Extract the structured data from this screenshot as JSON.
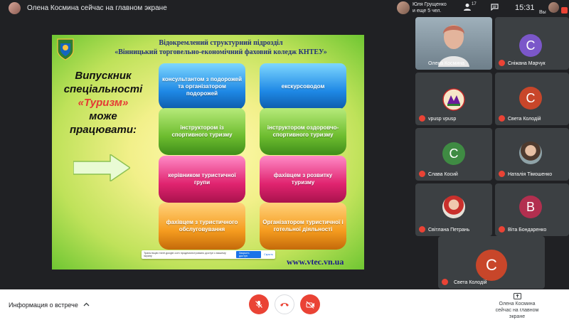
{
  "topbar": {
    "presenting": "Олена Космина сейчас на главном экране",
    "people_line1": "Юля Грущенко",
    "people_line2": "и еще 5 чел.",
    "people_count": "17",
    "clock": "15:31",
    "self_label": "Вы"
  },
  "slide": {
    "title_line1": "Відокремлений структурний підрозділ",
    "title_line2": "«Вінницький торговельно-економічний фаховий коледж КНТЕУ»",
    "lead_line1": "Випускник",
    "lead_line2": "спеціальності",
    "lead_accent": "«Туризм»",
    "lead_line3": "може",
    "lead_line4": "працювати:",
    "ribbons": [
      "консультантом з подорожей та організатором подорожей",
      "екскурсоводом",
      "інструктором із спортивного туризму",
      "інструктором оздоровчо-спортивного туризму",
      "керівником туристичної групи",
      "фахівцем з розвитку туризму",
      "фахівцем з туристичного обслуговування",
      "Організатором туристичної і готельної діяльності"
    ],
    "url": "www.vtec.vn.ua",
    "share_text": "Трансляцію meet.google.com продемонстровано доступ к вашему экрану",
    "share_hide": "Закрыть доступ",
    "share_stop": "Скрыть"
  },
  "participants": [
    {
      "name": "Олена Космина",
      "initial": ""
    },
    {
      "name": "Сніжана Марчук",
      "initial": "С",
      "color": "#7b57c9"
    },
    {
      "name": "vpusp vpusp",
      "initial": ""
    },
    {
      "name": "Света Колодій",
      "initial": "С",
      "color": "#c8462a"
    },
    {
      "name": "Слава Косий",
      "initial": "С",
      "color": "#3f8b43"
    },
    {
      "name": "Наталія Тімошенко",
      "initial": ""
    },
    {
      "name": "Світлана Петрань",
      "initial": ""
    },
    {
      "name": "Віта Бондаренко",
      "initial": "В",
      "color": "#b22f4f"
    },
    {
      "name": "Света Колодій",
      "initial": "С",
      "color": "#c8462a"
    }
  ],
  "bottombar": {
    "meeting_info": "Информация о встрече",
    "present_line1": "Олена Космина",
    "present_line2": "сейчас на главном экране"
  }
}
